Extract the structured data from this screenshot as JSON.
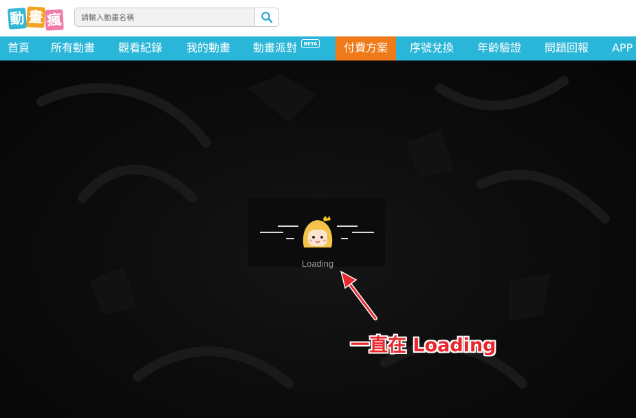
{
  "logo": {
    "chars": [
      "動",
      "畫",
      "瘋"
    ]
  },
  "search": {
    "placeholder": "請輸入動畫名稱",
    "value": ""
  },
  "nav": {
    "items": [
      "首頁",
      "所有動畫",
      "觀看紀錄",
      "我的動畫",
      "動畫派對",
      "付費方案",
      "序號兌換",
      "年齡驗證",
      "問題回報",
      "APP"
    ],
    "badge": "BETA",
    "active_index": 5
  },
  "player": {
    "loading_text": "Loading"
  },
  "annotation": {
    "text": "一直在 Loading",
    "color": "#e8262c"
  },
  "colors": {
    "nav_bg": "#29b6d9",
    "nav_active": "#ee7a1a"
  }
}
